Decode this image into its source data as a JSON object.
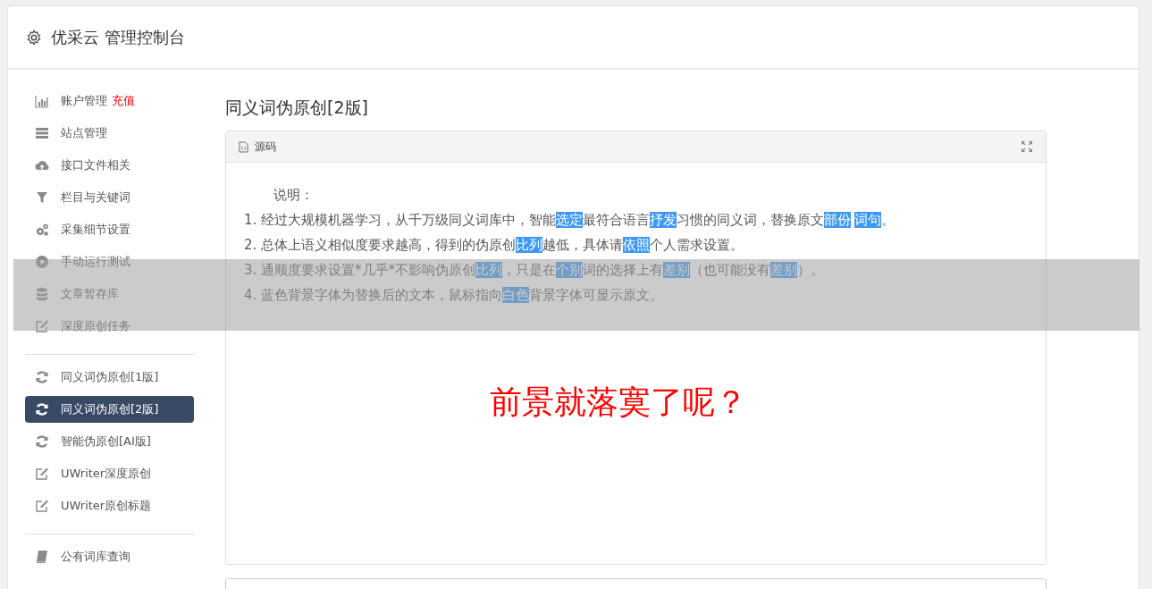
{
  "header": {
    "title": "优采云 管理控制台"
  },
  "sidebar": {
    "groups": [
      {
        "items": [
          {
            "label": "账户管理",
            "badge": "充值",
            "selected": false
          },
          {
            "label": "站点管理",
            "selected": false
          },
          {
            "label": "接口文件相关",
            "selected": false
          },
          {
            "label": "栏目与关键词",
            "selected": false
          },
          {
            "label": "采集细节设置",
            "selected": false
          },
          {
            "label": "手动运行测试",
            "selected": false
          },
          {
            "label": "文章暂存库",
            "selected": false
          },
          {
            "label": "深度原创任务",
            "selected": false
          }
        ]
      },
      {
        "items": [
          {
            "label": "同义词伪原创[1版]",
            "selected": false
          },
          {
            "label": "同义词伪原创[2版]",
            "selected": true
          },
          {
            "label": "智能伪原创[AI版]",
            "selected": false
          },
          {
            "label": "UWriter深度原创",
            "selected": false
          },
          {
            "label": "UWriter原创标题",
            "selected": false
          }
        ]
      },
      {
        "items": [
          {
            "label": "公有词库查询",
            "selected": false
          }
        ]
      }
    ]
  },
  "content": {
    "title": "同义词伪原创[2版]",
    "panel": {
      "tab": "源码",
      "heading": "说明：",
      "lines": [
        [
          {
            "text": "1. 经过大规模机器学习，从千万级同义词库中，智能",
            "highlighted": false
          },
          {
            "text": "选定",
            "highlighted": true
          },
          {
            "text": "最符合语言",
            "highlighted": false
          },
          {
            "text": "抒发",
            "highlighted": true
          },
          {
            "text": "习惯的同义词，替换原文",
            "highlighted": false
          },
          {
            "text": "部份",
            "highlighted": true
          },
          {
            "text": "词句",
            "highlighted": true
          },
          {
            "text": "。",
            "highlighted": false
          }
        ],
        [
          {
            "text": "2. 总体上语义相似度要求越高，得到的伪原创",
            "highlighted": false
          },
          {
            "text": "比列",
            "highlighted": true
          },
          {
            "text": "越低，具体请",
            "highlighted": false
          },
          {
            "text": "依照",
            "highlighted": true
          },
          {
            "text": "个人需求设置。",
            "highlighted": false
          }
        ],
        [
          {
            "text": "3. 通顺度要求设置*几乎*不影响伪原创",
            "highlighted": false
          },
          {
            "text": "比列",
            "highlighted": true
          },
          {
            "text": "，只是在",
            "highlighted": false
          },
          {
            "text": "个别",
            "highlighted": true
          },
          {
            "text": "词的选择上有",
            "highlighted": false
          },
          {
            "text": "差别",
            "highlighted": true
          },
          {
            "text": "（也可能没有",
            "highlighted": false
          },
          {
            "text": "差别",
            "highlighted": true
          },
          {
            "text": "）。",
            "highlighted": false
          }
        ],
        [
          {
            "text": "4. 蓝色背景字体为替换后的文本，鼠标指向",
            "highlighted": false
          },
          {
            "text": "白色",
            "highlighted": true
          },
          {
            "text": "背景字体可显示原文。",
            "highlighted": false
          }
        ]
      ],
      "caption": "前景就落寞了呢？"
    }
  }
}
